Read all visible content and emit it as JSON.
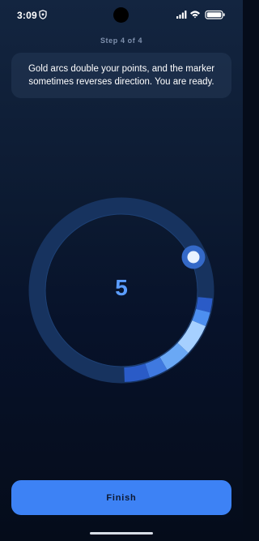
{
  "status_bar": {
    "time": "3:09",
    "left_icons": [
      "shield-icon"
    ],
    "right_icons": [
      "signal-icon",
      "wifi-icon",
      "battery-icon"
    ]
  },
  "step_label": "Step 4 of 4",
  "instruction": "Gold arcs double your points, and the marker sometimes reverses direction. You are ready.",
  "game": {
    "score": "5",
    "target_arc_colors": [
      "#2a5bc7",
      "#4d8ff0",
      "#a6d0ff",
      "#6aa8f5",
      "#3f79e0",
      "#2a5bc7"
    ],
    "ring_color": "#17335f",
    "marker_color": "#e8f2ff"
  },
  "finish_label": "Finish",
  "colors": {
    "accent": "#3d82f5",
    "background_top": "#132540",
    "background_bottom": "#050c1a"
  }
}
